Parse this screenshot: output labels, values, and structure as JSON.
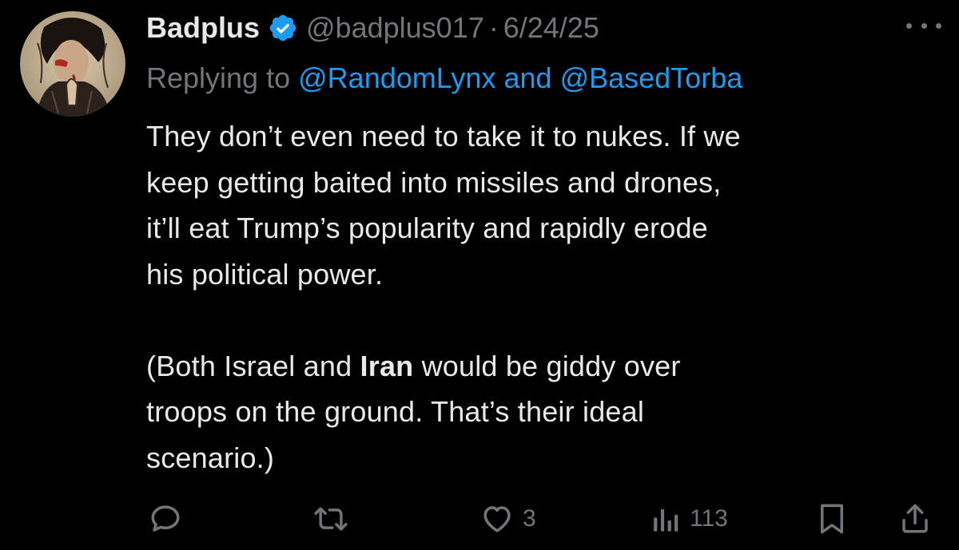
{
  "tweet": {
    "author": {
      "display_name": "Badplus",
      "verified_icon": "verified-badge-icon",
      "handle": "@badplus017",
      "separator": "·",
      "date": "6/24/25"
    },
    "reply_context": {
      "prefix": "Replying to",
      "mention_1": "@RandomLynx",
      "conjunction": "and",
      "mention_2": "@BasedTorba"
    },
    "text": {
      "line_1": "They don’t even need to take it to nukes. If we",
      "line_2": "keep getting baited into missiles and drones,",
      "line_3": "it’ll eat Trump’s popularity and rapidly erode",
      "line_4": "his political power.",
      "line_5_before": "(Both Israel and ",
      "line_5_bold": "Iran",
      "line_5_after": " would be giddy over",
      "line_6": "troops on the ground. That’s their ideal",
      "line_7": "scenario.)"
    },
    "actions": {
      "reply_icon": "reply-icon",
      "retweet_icon": "retweet-icon",
      "like_icon": "heart-icon",
      "like_count": "3",
      "views_icon": "views-icon",
      "view_count": "113",
      "bookmark_icon": "bookmark-icon",
      "share_icon": "share-icon"
    }
  },
  "colors": {
    "background": "#000000",
    "text_primary": "#e7e9ea",
    "text_secondary": "#71767b",
    "accent": "#1d9bf0"
  }
}
